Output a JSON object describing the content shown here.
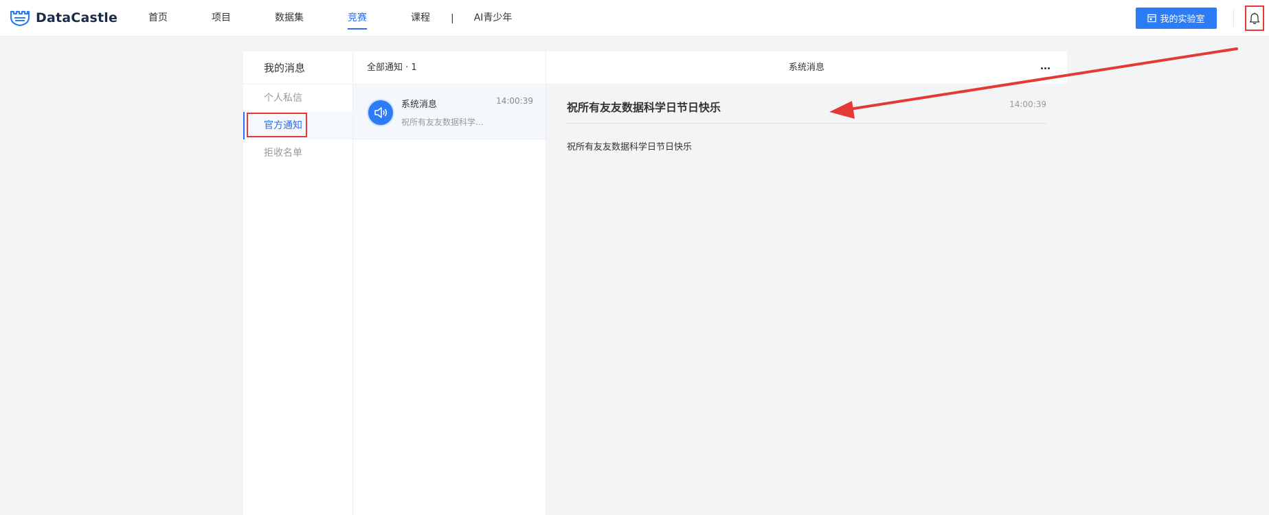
{
  "brand": {
    "name": "DataCastle",
    "color": "#1b2b4a"
  },
  "nav": {
    "items": [
      {
        "label": "首页",
        "active": false
      },
      {
        "label": "项目",
        "active": false
      },
      {
        "label": "数据集",
        "active": false
      },
      {
        "label": "竞赛",
        "active": true
      },
      {
        "label": "课程",
        "active": false
      }
    ],
    "separator": "|",
    "extra": "AI青少年",
    "accent": "#2b6cf0"
  },
  "toolbar": {
    "lab_button": "我的实验室",
    "lab_icon": "calendar-icon",
    "bell_icon": "bell-icon",
    "button_color": "#2b7cf6"
  },
  "sidebar": {
    "title": "我的消息",
    "items": [
      {
        "label": "个人私信",
        "active": false
      },
      {
        "label": "官方通知",
        "active": true
      },
      {
        "label": "拒收名单",
        "active": false
      }
    ]
  },
  "list": {
    "header": "全部通知 · 1",
    "messages": [
      {
        "title": "系统消息",
        "time": "14:00:39",
        "preview": "祝所有友友数据科学...",
        "icon": "speaker-icon"
      }
    ]
  },
  "detail": {
    "header_title": "系统消息",
    "more_icon": "more-icon",
    "title": "祝所有友友数据科学日节日快乐",
    "time": "14:00:39",
    "body": "祝所有友友数据科学日节日快乐"
  },
  "annotation": {
    "color": "#e53935"
  }
}
